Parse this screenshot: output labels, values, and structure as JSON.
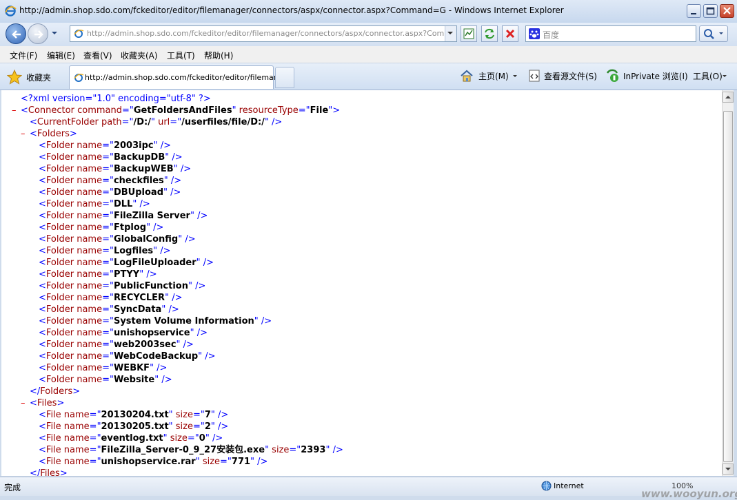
{
  "window": {
    "title": "http://admin.shop.sdo.com/fckeditor/editor/filemanager/connectors/aspx/connector.aspx?Command=G - Windows Internet Explorer"
  },
  "address_bar": {
    "url": "http://admin.shop.sdo.com/fckeditor/editor/filemanager/connectors/aspx/connector.aspx?Command=GetFo"
  },
  "search": {
    "placeholder": "百度"
  },
  "menu": [
    "文件(F)",
    "编辑(E)",
    "查看(V)",
    "收藏夹(A)",
    "工具(T)",
    "帮助(H)"
  ],
  "favorites_label": "收藏夹",
  "tab": {
    "title": "http://admin.shop.sdo.com/fckeditor/editor/filemanag..."
  },
  "commands": {
    "home": "主页(M)",
    "view_source": "查看源文件(S)",
    "inprivate": "InPrivate 浏览(I)",
    "tools": "工具(O)"
  },
  "xml": {
    "declaration": "<?xml version=\"1.0\" encoding=\"utf-8\" ?>",
    "connector": {
      "command": "GetFoldersAndFiles",
      "resourceType": "File"
    },
    "current_folder": {
      "path": "/D:/",
      "url": "/userfiles/file/D:/"
    },
    "folders": [
      "2003ipc",
      "BackupDB",
      "BackupWEB",
      "checkfiles",
      "DBUpload",
      "DLL",
      "FileZilla Server",
      "Ftplog",
      "GlobalConfig",
      "Logfiles",
      "LogFileUploader",
      "PTYY",
      "PublicFunction",
      "RECYCLER",
      "SyncData",
      "System Volume Information",
      "unishopservice",
      "web2003sec",
      "WebCodeBackup",
      "WEBKF",
      "Website"
    ],
    "files": [
      {
        "name": "20130204.txt",
        "size": "7"
      },
      {
        "name": "20130205.txt",
        "size": "2"
      },
      {
        "name": "eventlog.txt",
        "size": "0"
      },
      {
        "name": "FileZilla_Server-0_9_27安装包.exe",
        "size": "2393"
      },
      {
        "name": "unishopservice.rar",
        "size": "771"
      }
    ]
  },
  "status": {
    "text": "完成",
    "zone": "Internet",
    "zoom": "100%"
  },
  "watermark": "www.wooyun.org"
}
